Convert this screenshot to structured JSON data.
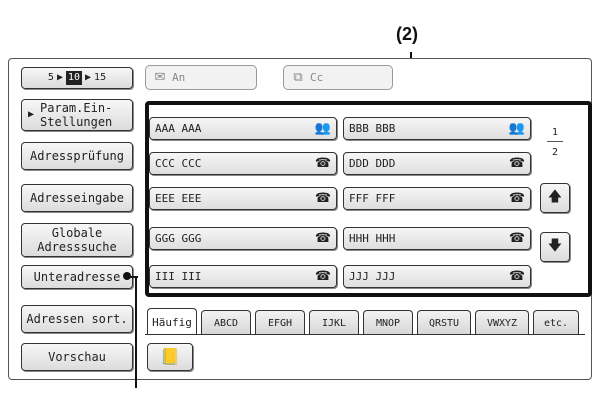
{
  "callout_label": "(2)",
  "pager": {
    "left": "5",
    "mid": "10",
    "right": "15"
  },
  "fields": {
    "to_label": "An",
    "cc_label": "Cc"
  },
  "side": [
    {
      "id": "param",
      "label_1": "Param.Ein-",
      "label_2": "Stellungen"
    },
    {
      "id": "check",
      "label": "Adressprüfung"
    },
    {
      "id": "input",
      "label": "Adresseingabe"
    },
    {
      "id": "global",
      "label_1": "Globale",
      "label_2": "Adresssuche"
    },
    {
      "id": "sub",
      "label": "Unteradresse"
    },
    {
      "id": "sort",
      "label": "Adressen sort."
    },
    {
      "id": "preview",
      "label": "Vorschau"
    }
  ],
  "entries": [
    {
      "name": "AAA AAA",
      "icon": "group-icon"
    },
    {
      "name": "BBB BBB",
      "icon": "group-icon"
    },
    {
      "name": "CCC CCC",
      "icon": "phone-icon"
    },
    {
      "name": "DDD DDD",
      "icon": "phone-icon"
    },
    {
      "name": "EEE EEE",
      "icon": "phone-icon"
    },
    {
      "name": "FFF FFF",
      "icon": "phone-icon"
    },
    {
      "name": "GGG GGG",
      "icon": "phone-icon"
    },
    {
      "name": "HHH HHH",
      "icon": "phone-icon"
    },
    {
      "name": "III III",
      "icon": "phone-icon"
    },
    {
      "name": "JJJ JJJ",
      "icon": "phone-icon"
    }
  ],
  "page": {
    "current": "1",
    "total": "2"
  },
  "tabs": [
    "Häufig",
    "ABCD",
    "EFGH",
    "IJKL",
    "MNOP",
    "QRSTU",
    "VWXYZ",
    "etc."
  ]
}
